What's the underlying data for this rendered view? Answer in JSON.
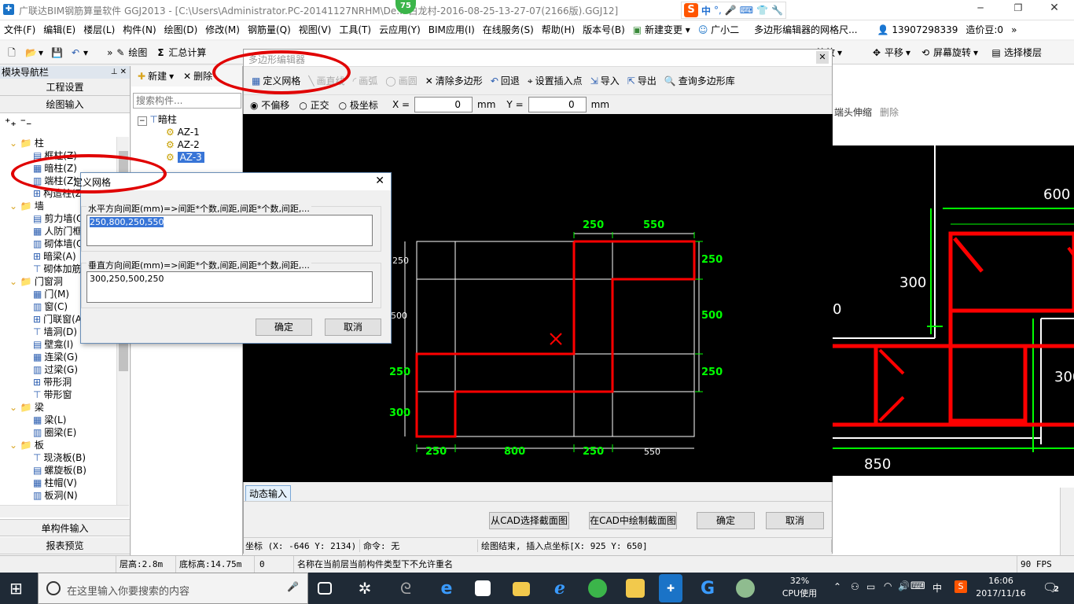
{
  "app": {
    "title": "广联达BIM钢筋算量软件 GGJ2013 - [C:\\Users\\Administrator.PC-20141127NRHM\\De... 白龙村-2016-08-25-13-27-07(2166版).GGJ12]",
    "badge": "75",
    "ime_label": "中"
  },
  "menu": [
    "文件(F)",
    "编辑(E)",
    "楼层(L)",
    "构件(N)",
    "绘图(D)",
    "修改(M)",
    "钢筋量(Q)",
    "视图(V)",
    "工具(T)",
    "云应用(Y)",
    "BIM应用(I)",
    "在线服务(S)",
    "帮助(H)",
    "版本号(B)",
    "新建变更",
    "广小二",
    "多边形编辑器的网格尺...",
    "13907298339",
    "造价豆:0"
  ],
  "toolbar": {
    "draw": "绘图",
    "sum": "汇总计算",
    "zoom": "缩放",
    "pan": "平移",
    "rotate": "屏幕旋转",
    "select_floor": "选择楼层"
  },
  "nav": {
    "header": "模块导航栏",
    "project_settings": "工程设置",
    "draw_input": "绘图输入",
    "single_input": "单构件输入",
    "report": "报表预览",
    "tree": [
      {
        "label": "柱",
        "level": 0
      },
      {
        "label": "框柱(Z)",
        "level": 1
      },
      {
        "label": "暗柱(Z)",
        "level": 1
      },
      {
        "label": "端柱(Z)",
        "level": 1
      },
      {
        "label": "构造柱(Z)",
        "level": 1
      },
      {
        "label": "墙",
        "level": 0
      },
      {
        "label": "剪力墙(Q)",
        "level": 1
      },
      {
        "label": "人防门框墙",
        "level": 1
      },
      {
        "label": "砌体墙(Q)",
        "level": 1
      },
      {
        "label": "暗梁(A)",
        "level": 1
      },
      {
        "label": "砌体加筋",
        "level": 1
      },
      {
        "label": "门窗洞",
        "level": 0
      },
      {
        "label": "门(M)",
        "level": 1
      },
      {
        "label": "窗(C)",
        "level": 1
      },
      {
        "label": "门联窗(A)",
        "level": 1
      },
      {
        "label": "墙洞(D)",
        "level": 1
      },
      {
        "label": "壁龛(I)",
        "level": 1
      },
      {
        "label": "连梁(G)",
        "level": 1
      },
      {
        "label": "过梁(G)",
        "level": 1
      },
      {
        "label": "带形洞",
        "level": 1
      },
      {
        "label": "带形窗",
        "level": 1
      },
      {
        "label": "梁",
        "level": 0
      },
      {
        "label": "梁(L)",
        "level": 1
      },
      {
        "label": "圈梁(E)",
        "level": 1
      },
      {
        "label": "板",
        "level": 0
      },
      {
        "label": "现浇板(B)",
        "level": 1
      },
      {
        "label": "螺旋板(B)",
        "level": 1
      },
      {
        "label": "柱帽(V)",
        "level": 1
      },
      {
        "label": "板洞(N)",
        "level": 1
      }
    ]
  },
  "components": {
    "new": "新建",
    "delete": "删除",
    "search_placeholder": "搜索构件...",
    "root": "暗柱",
    "items": [
      "AZ-1",
      "AZ-2",
      "AZ-3"
    ]
  },
  "poly_editor": {
    "title": "多边形编辑器",
    "tools": [
      "定义网格",
      "画直线",
      "画弧",
      "画圆",
      "清除多边形",
      "回退",
      "设置插入点",
      "导入",
      "导出",
      "查询多边形库"
    ],
    "options": [
      "不偏移",
      "正交",
      "极坐标"
    ],
    "x_label": "X =",
    "y_label": "Y =",
    "x_value": "0",
    "y_value": "0",
    "unit": "mm",
    "dyn_input": "动态输入",
    "btn_from_cad": "从CAD选择截面图",
    "btn_draw_cad": "在CAD中绘制截面图",
    "btn_ok": "确定",
    "btn_cancel": "取消",
    "status_coord": "坐标 (X: -646 Y: 2134)",
    "status_cmd": "命令: 无",
    "status_msg": "绘图结束, 插入点坐标[X: 925 Y: 650]",
    "dims_top": [
      "250",
      "550"
    ],
    "dims_bottom": [
      "250",
      "800",
      "250",
      "550"
    ],
    "dims_right": [
      "250",
      "500",
      "250"
    ],
    "dims_left": [
      "250",
      "500",
      "250",
      "300"
    ]
  },
  "grid_dialog": {
    "title": "定义网格",
    "h_label": "水平方向间距(mm)=>间距*个数,间距,间距*个数,间距,...",
    "h_value": "250,800,250,550",
    "v_label": "垂直方向间距(mm)=>间距*个数,间距,间距*个数,间距,...",
    "v_value": "300,250,500,250",
    "ok": "确定",
    "cancel": "取消"
  },
  "right_panel": {
    "ext": "端头伸缩",
    "del": "删除",
    "dims": [
      "600",
      "300",
      "0",
      "850",
      "300"
    ]
  },
  "status": {
    "floor_height": "层高:2.8m",
    "base_height": "底标高:14.75m",
    "zero": "0",
    "message": "名称在当前层当前构件类型下不允许重名",
    "fps": "90 FPS"
  },
  "taskbar": {
    "search_placeholder": "在这里输入你要搜索的内容",
    "cpu": "32%",
    "cpu_label": "CPU使用",
    "ime": "中",
    "time": "16:06",
    "date": "2017/11/16",
    "notif": "2"
  },
  "colors": {
    "cad_red": "#ff0000",
    "cad_green": "#00ff00",
    "highlight": "#e00000"
  }
}
